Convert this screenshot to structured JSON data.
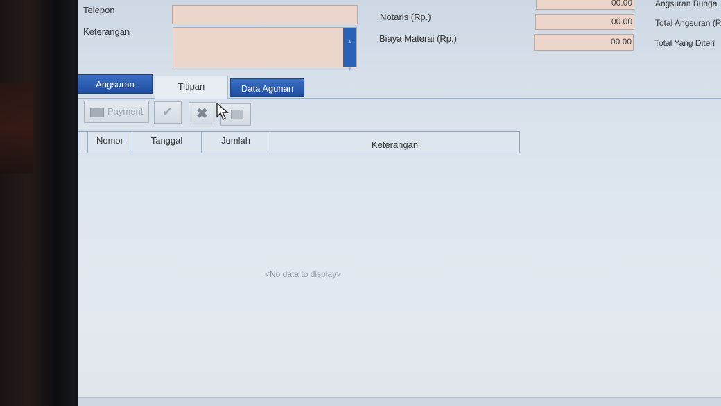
{
  "form": {
    "telepon_label": "Telepon",
    "keterangan_label": "Keterangan",
    "notaris_label": "Notaris (Rp.)",
    "biaya_materai_label": "Biaya Materai (Rp.)",
    "top_value": "00.00",
    "notaris_value": "00.00",
    "materai_value": "00.00",
    "angsuran_bunga_label": "Angsuran Bunga",
    "total_angsuran_label": "Total Angsuran (R",
    "total_diterima_label": "Total Yang Diteri"
  },
  "tabs": [
    {
      "label": "Angsuran",
      "active": false
    },
    {
      "label": "Titipan",
      "active": true
    },
    {
      "label": "Data Agunan",
      "active": false
    }
  ],
  "toolbar": {
    "payment_label": "Payment"
  },
  "grid": {
    "columns": [
      "Nomor",
      "Tanggal",
      "Jumlah",
      "Keterangan"
    ],
    "empty_text": "<No data to display>"
  },
  "colors": {
    "tab_blue": "#1f4ea0",
    "field_bg": "#ecd6cb",
    "screen_bg": "#dee6ee"
  }
}
